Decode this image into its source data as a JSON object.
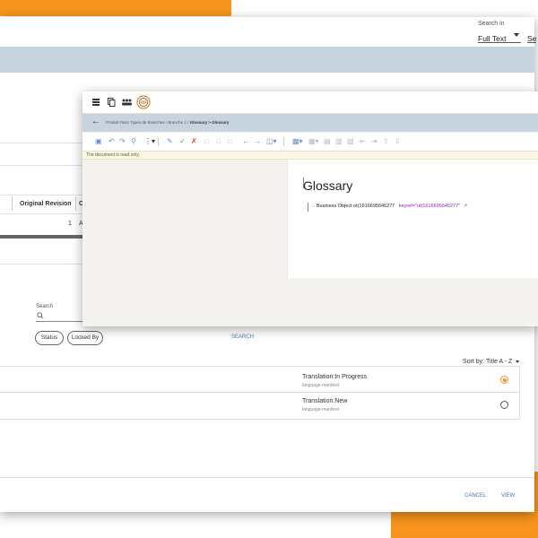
{
  "colors": {
    "accent_orange": "#f7941d",
    "toolbar_blue": "#c8d3e0",
    "link_blue": "#4a72b5",
    "keyref_purple": "#8e24aa"
  },
  "back_panel": {
    "search_in_label": "Search in",
    "search_in_value": "Full Text",
    "search_partial": "Sea",
    "table_header_original_revision": "Original Revision",
    "table_header_partial": "C",
    "row_value": "1",
    "row_partial": "A",
    "search_label": "Search",
    "filter_status": "Status",
    "filter_locked_by": "Locked By",
    "search_button": "SEARCH",
    "sort_label": "Sort by:",
    "sort_value": "Title A - Z",
    "results": [
      {
        "title": "Translation:In Progress",
        "subtitle": "language-manifest",
        "selected": true
      },
      {
        "title": "Translation:New",
        "subtitle": "language-manifest",
        "selected": false
      }
    ],
    "cancel_button": "CANCEL",
    "view_button": "VIEW"
  },
  "front_panel": {
    "breadcrumb": [
      "Produit Tests Types de Branches",
      "Branche 1",
      "Glossary",
      "Glossary"
    ],
    "readonly_notice": "The document is read only.",
    "doc_title": "Glossary",
    "entry_text": "Business Object ot(1616695645277",
    "entry_keyref": "keyref=\"ot(1616695645277\""
  }
}
